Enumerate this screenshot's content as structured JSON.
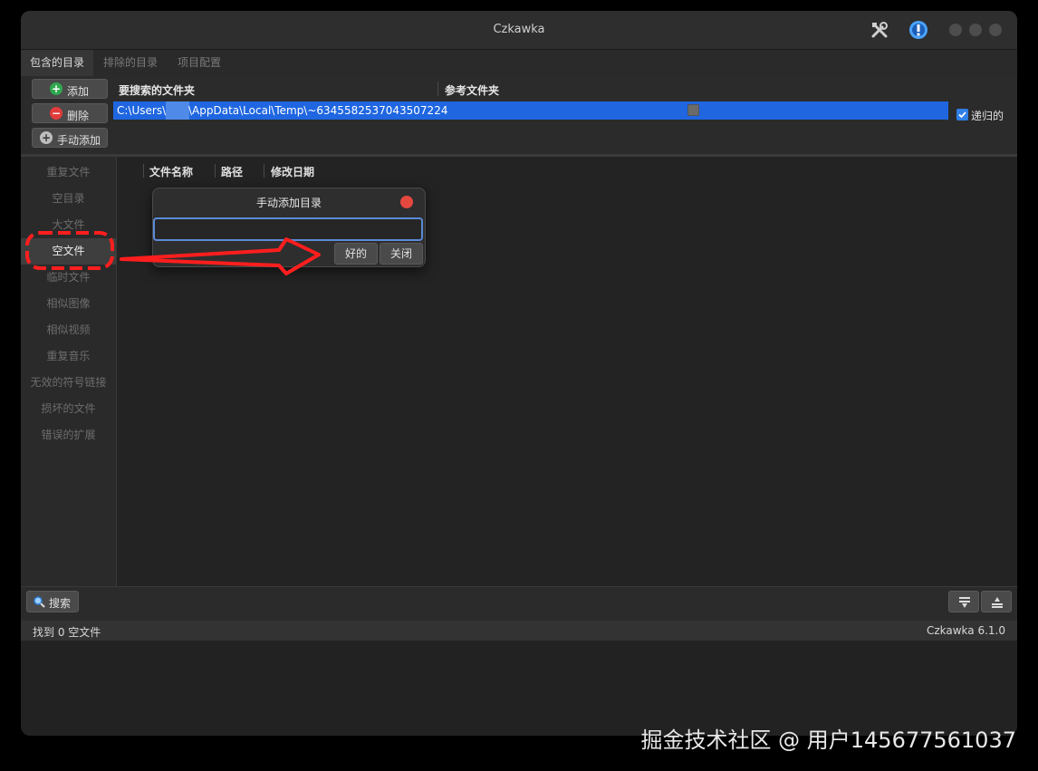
{
  "window": {
    "title": "Czkawka"
  },
  "titlebar_icons": [
    "tools-icon",
    "info-icon"
  ],
  "tabs": [
    {
      "label": "包含的目录",
      "active": true
    },
    {
      "label": "排除的目录",
      "active": false
    },
    {
      "label": "项目配置",
      "active": false
    }
  ],
  "dir_panel": {
    "buttons": {
      "add": "添加",
      "remove": "删除",
      "manual_add": "手动添加"
    },
    "columns": {
      "search_folder": "要搜索的文件夹",
      "reference_folder": "参考文件夹"
    },
    "rows": [
      {
        "path_prefix": "C:\\Users\\",
        "path_suffix": "\\AppData\\Local\\Temp\\~6345582537043507224",
        "reference": false
      }
    ],
    "recursive_label": "递归的",
    "recursive_checked": true
  },
  "sidebar": {
    "items": [
      {
        "label": "重复文件",
        "active": false
      },
      {
        "label": "空目录",
        "active": false
      },
      {
        "label": "大文件",
        "active": false
      },
      {
        "label": "空文件",
        "active": true
      },
      {
        "label": "临时文件",
        "active": false
      },
      {
        "label": "相似图像",
        "active": false
      },
      {
        "label": "相似视频",
        "active": false
      },
      {
        "label": "重复音乐",
        "active": false
      },
      {
        "label": "无效的符号链接",
        "active": false
      },
      {
        "label": "损坏的文件",
        "active": false
      },
      {
        "label": "错误的扩展",
        "active": false
      }
    ]
  },
  "results": {
    "columns": [
      "文件名称",
      "路径",
      "修改日期"
    ]
  },
  "dialog": {
    "title": "手动添加目录",
    "input_value": "",
    "ok_label": "好的",
    "close_label": "关闭"
  },
  "bottom": {
    "search_label": "搜索"
  },
  "status": {
    "left": "找到 0 空文件",
    "right": "Czkawka 6.1.0"
  },
  "watermark": "掘金技术社区 @ 用户145677561037",
  "colors": {
    "selection": "#1f66e0",
    "add_green": "#2fa84f",
    "remove_red": "#e23b3b",
    "annotation_red": "#ff1e1e"
  }
}
